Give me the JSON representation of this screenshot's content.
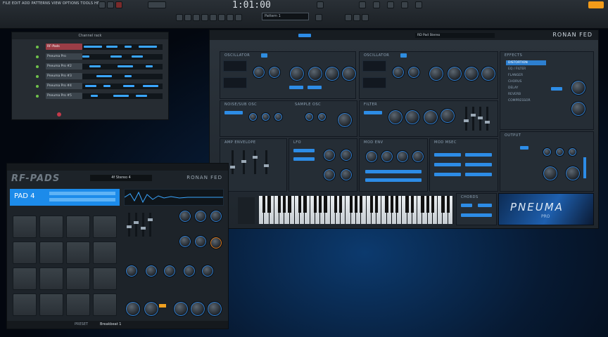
{
  "daw": {
    "menu": "FILE EDIT ADD PATTERNS VIEW OPTIONS TOOLS HELP",
    "song_position": "1:01:00",
    "pattern": "Pattern 1",
    "accent": "#f39b19"
  },
  "channel_rack": {
    "title": "Channel rack",
    "channels": [
      {
        "name": "RF-Pads",
        "selected": true
      },
      {
        "name": "Pneuma Pro",
        "selected": false
      },
      {
        "name": "Pneuma Pro #2",
        "selected": false
      },
      {
        "name": "Pneuma Pro #3",
        "selected": false
      },
      {
        "name": "Pneuma Pro #4",
        "selected": false
      },
      {
        "name": "Pneuma Pro #5",
        "selected": false
      }
    ]
  },
  "synth": {
    "brand": "RONAN FED",
    "logo": "PNEUMA",
    "logo_sub": "PRO",
    "sections": {
      "osc1": "OSCILLATOR",
      "osc2": "OSCILLATOR",
      "effects": "EFFECTS",
      "noise": "NOISE/SUB OSC",
      "sample": "SAMPLE OSC",
      "filter": "FILTER",
      "env": "AMP ENVELOPE",
      "lfo": "LFO",
      "mod_env": "MOD ENV",
      "mod_mx": "MOD MSEC",
      "output": "OUTPUT",
      "chords": "CHORDS"
    },
    "preset": "RD Pad Stereo",
    "fx_list": [
      "DISTORTION",
      "EQ / FILTER",
      "FLANGER",
      "CHORUS",
      "DELAY",
      "REVERB",
      "COMPRESSOR"
    ]
  },
  "pads": {
    "logo": "RF-PADS",
    "brand": "RONAN FED",
    "preset": "4f Stereo 4",
    "pad_label": "PAD 4",
    "bottom_label": "PRESET",
    "bottom_preset": "Breakbeat 1",
    "colors": {
      "display": "#1c8bea"
    }
  }
}
